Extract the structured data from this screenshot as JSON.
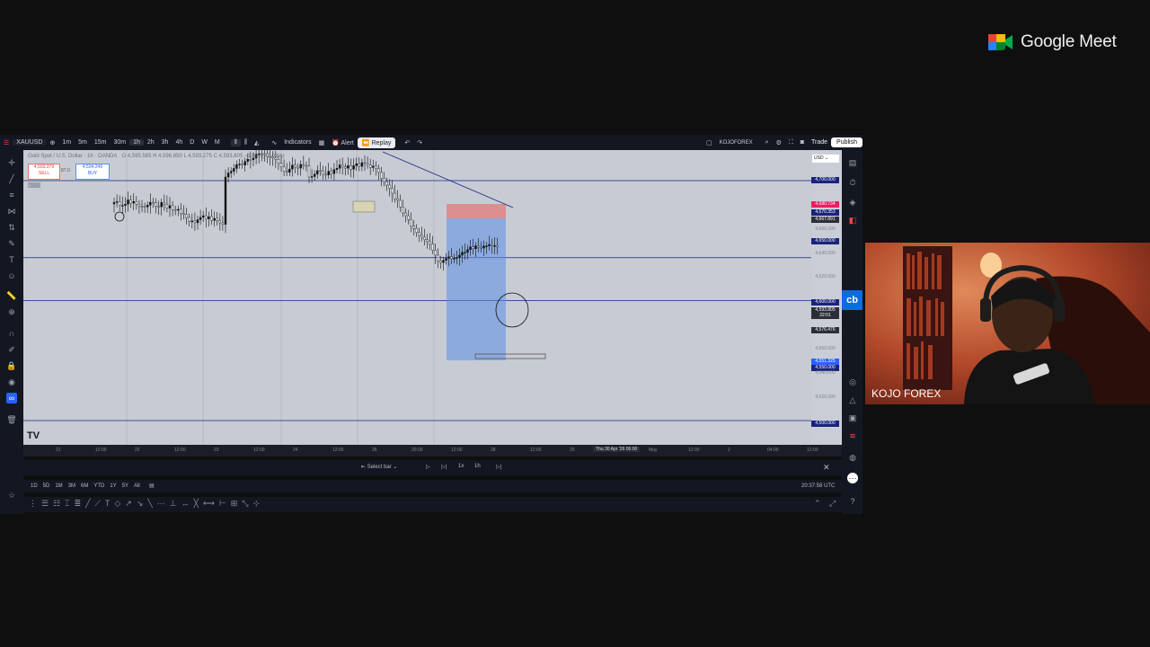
{
  "meet": {
    "brand": "Google Meet"
  },
  "topbar": {
    "symbol": "XAUUSD",
    "timeframes": [
      "1m",
      "5m",
      "15m",
      "30m",
      "1h",
      "2h",
      "3h",
      "4h",
      "D",
      "W",
      "M"
    ],
    "active_timeframe": "1h",
    "indicators": "Indicators",
    "alert": "Alert",
    "replay": "Replay",
    "account": "KOJOFOREX",
    "trade": "Trade",
    "publish": "Publish"
  },
  "chart": {
    "legend": "Gold Spot / U.S. Dollar · 1h · OANDA",
    "ohlc": "O 4,595.565  H 4,596.650  L 4,593.275  C 4,593.805  −1.890 (−0.04%)",
    "sell_price": "4,593.379",
    "sell_label": "SELL",
    "spread": "87.0",
    "buy_price": "4,594.249",
    "buy_label": "BUY",
    "currency": "USD",
    "price_labels": [
      {
        "text": "4,700.000",
        "style": "line"
      },
      {
        "text": "4,680.734",
        "style": "red"
      },
      {
        "text": "4,670.353",
        "style": "line"
      },
      {
        "text": "4,667.891",
        "style": "gray"
      },
      {
        "text": "4,660.000",
        "style": "faint"
      },
      {
        "text": "4,650.000",
        "style": "line"
      },
      {
        "text": "4,640.000",
        "style": "faint"
      },
      {
        "text": "4,620.000",
        "style": "faint"
      },
      {
        "text": "4,600.000",
        "style": "line"
      },
      {
        "text": "4,593.805",
        "style": "gray"
      },
      {
        "text": "22:01",
        "style": "gray"
      },
      {
        "text": "4,576.476",
        "style": "gray"
      },
      {
        "text": "4,560.000",
        "style": "faint"
      },
      {
        "text": "4,551.325",
        "style": "blue"
      },
      {
        "text": "4,550.000",
        "style": "line"
      },
      {
        "text": "4,540.000",
        "style": "faint"
      },
      {
        "text": "4,520.000",
        "style": "faint"
      },
      {
        "text": "4,500.000",
        "style": "line"
      }
    ],
    "time_labels": [
      "21",
      "12:00",
      "22",
      "12:00",
      "23",
      "12:00",
      "24",
      "12:00",
      "26",
      "20:00",
      "12:00",
      "28",
      "12:00",
      "29",
      "12:00",
      "May",
      "12:00",
      "2",
      "04:00",
      "12:00"
    ],
    "crosshair_time": "Thu 30 Apr '26  06:00"
  },
  "replay_bar": {
    "select_bar": "Select bar",
    "speed": "1x",
    "interval": "1h"
  },
  "range_bar": {
    "ranges": [
      "1D",
      "5D",
      "1M",
      "3M",
      "6M",
      "YTD",
      "1Y",
      "5Y",
      "All"
    ],
    "clock": "20:37:58 UTC"
  },
  "webcam": {
    "name": "KOJO FOREX"
  },
  "badge": {
    "text": "cb"
  },
  "colors": {
    "accent": "#2962ff",
    "chart_bg": "#c7ccd4",
    "level_line": "#1a237e",
    "sl_zone": "#e57373",
    "tp_zone": "#5c8ee6"
  }
}
